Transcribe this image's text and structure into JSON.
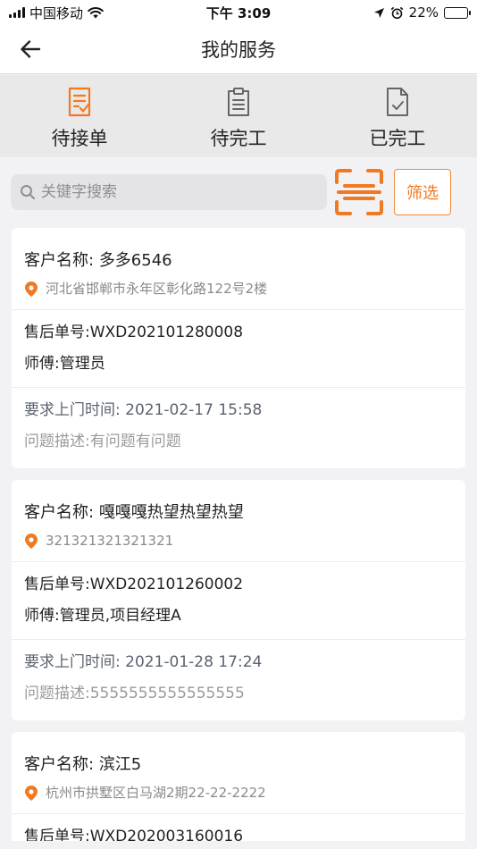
{
  "status_bar": {
    "carrier": "中国移动",
    "time": "下午 3:09",
    "battery": "22%",
    "battery_level": 0.22
  },
  "nav": {
    "title": "我的服务"
  },
  "tabs": [
    {
      "label": "待接单",
      "active": true
    },
    {
      "label": "待完工",
      "active": false
    },
    {
      "label": "已完工",
      "active": false
    }
  ],
  "search": {
    "placeholder": "关键字搜索",
    "value": "",
    "filter_label": "筛选"
  },
  "colors": {
    "accent": "#f07a22",
    "text": "#222222",
    "muted": "#9a9a9a"
  },
  "orders": [
    {
      "customer_label": "客户名称:",
      "customer": "多多6546",
      "address": "河北省邯郸市永年区彰化路122号2楼",
      "order_no": "售后单号:WXD202101280008",
      "master": "师傅:管理员",
      "visit_time": "要求上门时间: 2021-02-17 15:58",
      "description": "问题描述:有问题有问题"
    },
    {
      "customer_label": "客户名称:",
      "customer": "嘎嘎嘎热望热望热望",
      "address": "321321321321321",
      "order_no": "售后单号:WXD202101260002",
      "master": "师傅:管理员,项目经理A",
      "visit_time": "要求上门时间: 2021-01-28 17:24",
      "description": "问题描述:5555555555555555"
    },
    {
      "customer_label": "客户名称:",
      "customer": "滨江5",
      "address": "杭州市拱墅区白马湖2期22-22-2222",
      "order_no": "售后单号:WXD202003160016",
      "master": "师傅:管理员",
      "visit_time": "",
      "description": ""
    }
  ]
}
